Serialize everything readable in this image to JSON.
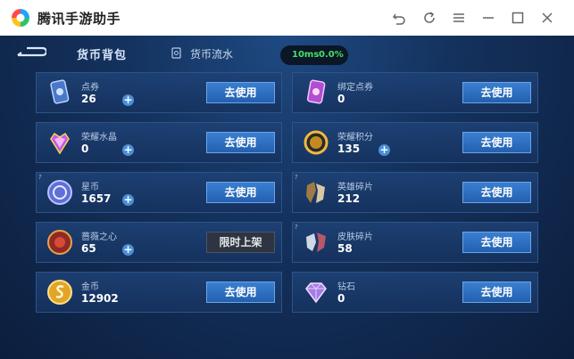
{
  "app": {
    "title": "腾讯手游助手"
  },
  "window_controls": [
    "back-icon",
    "refresh-icon",
    "menu-icon",
    "minimize-icon",
    "maximize-icon",
    "close-icon"
  ],
  "tabs": {
    "active": "货币背包",
    "flow": "货币流水"
  },
  "network": {
    "latency": "10ms",
    "loss": "0.0%"
  },
  "colors": {
    "accent": "#2360b0",
    "ok": "#45e06a"
  },
  "currencies": [
    {
      "name": "点券",
      "value": "26",
      "plus": true,
      "button": "去使用",
      "icon": "coupon-icon",
      "info": false
    },
    {
      "name": "绑定点券",
      "value": "0",
      "plus": false,
      "button": "去使用",
      "icon": "bound-coupon-icon",
      "info": false
    },
    {
      "name": "荣耀水晶",
      "value": "0",
      "plus": true,
      "button": "去使用",
      "icon": "glory-crystal-icon",
      "info": false
    },
    {
      "name": "荣耀积分",
      "value": "135",
      "plus": true,
      "button": "去使用",
      "icon": "glory-points-icon",
      "info": false
    },
    {
      "name": "星币",
      "value": "1657",
      "plus": true,
      "button": "去使用",
      "icon": "star-coin-icon",
      "info": true
    },
    {
      "name": "英雄碎片",
      "value": "212",
      "plus": false,
      "button": "去使用",
      "icon": "hero-fragment-icon",
      "info": true
    },
    {
      "name": "蔷薇之心",
      "value": "65",
      "plus": true,
      "button": "限时上架",
      "icon": "rose-heart-icon",
      "info": false,
      "disabled": true
    },
    {
      "name": "皮肤碎片",
      "value": "58",
      "plus": false,
      "button": "去使用",
      "icon": "skin-fragment-icon",
      "info": true
    },
    {
      "name": "金币",
      "value": "12902",
      "plus": false,
      "button": "去使用",
      "icon": "gold-coin-icon",
      "info": false
    },
    {
      "name": "钻石",
      "value": "0",
      "plus": false,
      "button": "去使用",
      "icon": "diamond-icon",
      "info": false
    }
  ]
}
